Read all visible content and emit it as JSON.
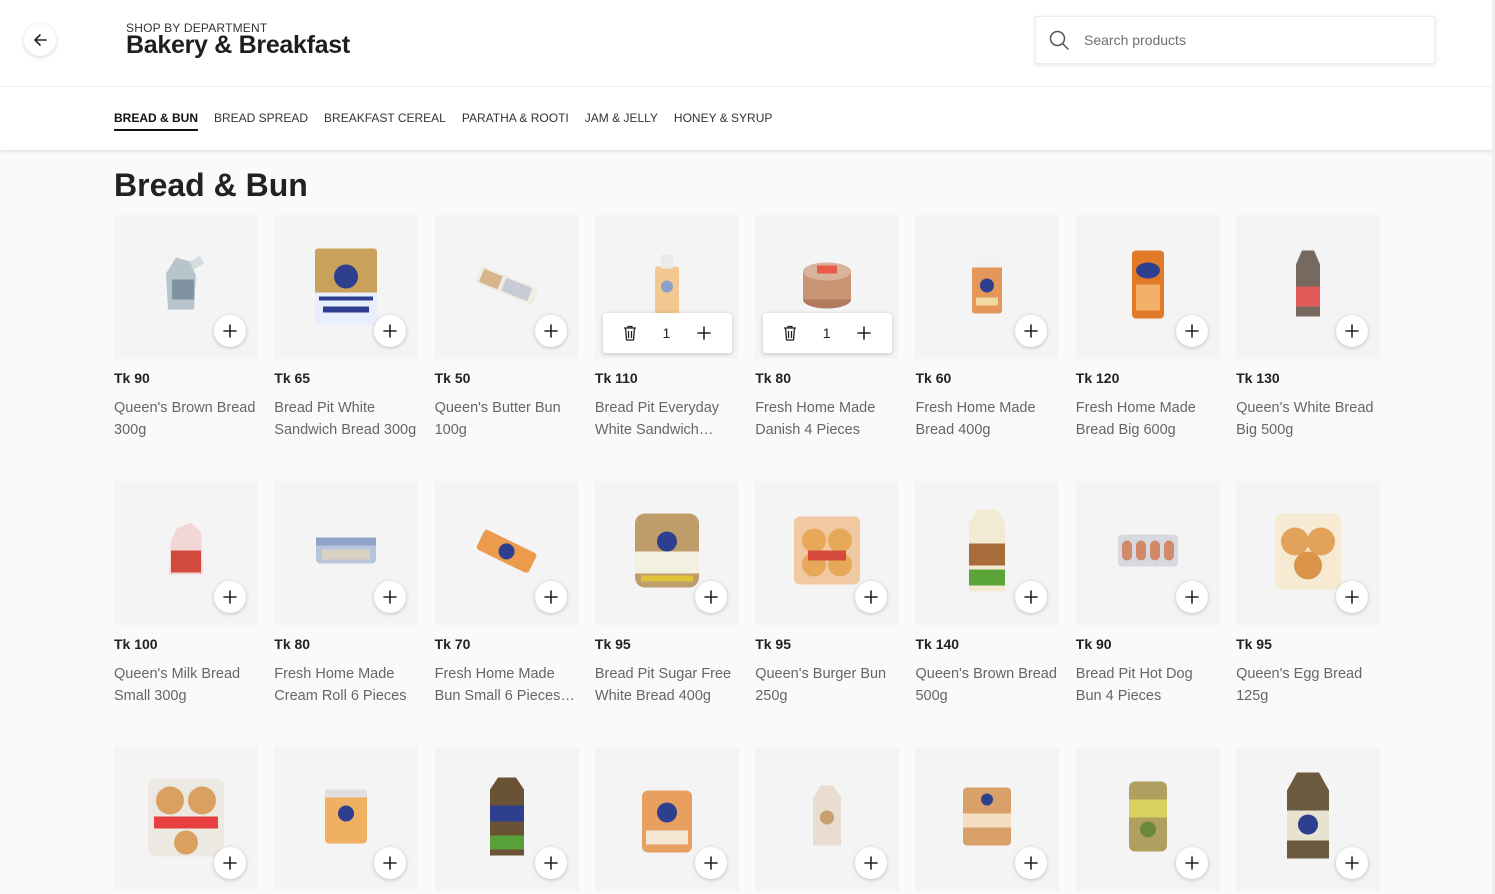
{
  "header": {
    "back_label": "Back",
    "subtitle": "SHOP BY DEPARTMENT",
    "title": "Bakery & Breakfast",
    "search_placeholder": "Search products"
  },
  "tabs": [
    {
      "label": "BREAD & BUN",
      "active": true
    },
    {
      "label": "BREAD SPREAD",
      "active": false
    },
    {
      "label": "BREAKFAST CEREAL",
      "active": false
    },
    {
      "label": "PARATHA & ROOTI",
      "active": false
    },
    {
      "label": "JAM & JELLY",
      "active": false
    },
    {
      "label": "HONEY & SYRUP",
      "active": false
    }
  ],
  "section": {
    "title": "Bread & Bun"
  },
  "icons": {
    "back": "arrow-left-icon",
    "search": "search-icon",
    "add": "plus-icon",
    "delete": "trash-icon"
  },
  "colors": {
    "page_bg": "#fafafa",
    "card_bg": "#f4f4f4",
    "text": "#222222",
    "muted": "#666666"
  },
  "products": [
    {
      "price": "Tk 90",
      "name": "Queen's Brown Bread 300g",
      "in_cart": false,
      "qty": 0
    },
    {
      "price": "Tk 65",
      "name": "Bread Pit White Sandwich Bread 300g",
      "in_cart": false,
      "qty": 0
    },
    {
      "price": "Tk 50",
      "name": "Queen's Butter Bun 100g",
      "in_cart": false,
      "qty": 0
    },
    {
      "price": "Tk 110",
      "name": "Bread Pit Everyday White Sandwich…",
      "in_cart": true,
      "qty": "1"
    },
    {
      "price": "Tk 80",
      "name": "Fresh Home Made Danish 4 Pieces",
      "in_cart": true,
      "qty": "1"
    },
    {
      "price": "Tk 60",
      "name": "Fresh Home Made Bread 400g",
      "in_cart": false,
      "qty": 0
    },
    {
      "price": "Tk 120",
      "name": "Fresh Home Made Bread Big 600g",
      "in_cart": false,
      "qty": 0
    },
    {
      "price": "Tk 130",
      "name": "Queen's White Bread Big 500g",
      "in_cart": false,
      "qty": 0
    },
    {
      "price": "Tk 100",
      "name": "Queen's Milk Bread Small 300g",
      "in_cart": false,
      "qty": 0
    },
    {
      "price": "Tk 80",
      "name": "Fresh Home Made Cream Roll 6 Pieces",
      "in_cart": false,
      "qty": 0
    },
    {
      "price": "Tk 70",
      "name": "Fresh Home Made Bun Small 6 Pieces…",
      "in_cart": false,
      "qty": 0
    },
    {
      "price": "Tk 95",
      "name": "Bread Pit Sugar Free White Bread 400g",
      "in_cart": false,
      "qty": 0
    },
    {
      "price": "Tk 95",
      "name": "Queen's Burger Bun 250g",
      "in_cart": false,
      "qty": 0
    },
    {
      "price": "Tk 140",
      "name": "Queen's Brown Bread 500g",
      "in_cart": false,
      "qty": 0
    },
    {
      "price": "Tk 90",
      "name": "Bread Pit Hot Dog Bun 4 Pieces",
      "in_cart": false,
      "qty": 0
    },
    {
      "price": "Tk 95",
      "name": "Queen's Egg Bread 125g",
      "in_cart": false,
      "qty": 0
    },
    {
      "price": "",
      "name": "",
      "in_cart": false,
      "qty": 0
    },
    {
      "price": "",
      "name": "",
      "in_cart": false,
      "qty": 0
    },
    {
      "price": "",
      "name": "",
      "in_cart": false,
      "qty": 0
    },
    {
      "price": "",
      "name": "",
      "in_cart": false,
      "qty": 0
    },
    {
      "price": "",
      "name": "",
      "in_cart": false,
      "qty": 0
    },
    {
      "price": "",
      "name": "",
      "in_cart": false,
      "qty": 0
    },
    {
      "price": "",
      "name": "",
      "in_cart": false,
      "qty": 0
    },
    {
      "price": "",
      "name": "",
      "in_cart": false,
      "qty": 0
    }
  ]
}
